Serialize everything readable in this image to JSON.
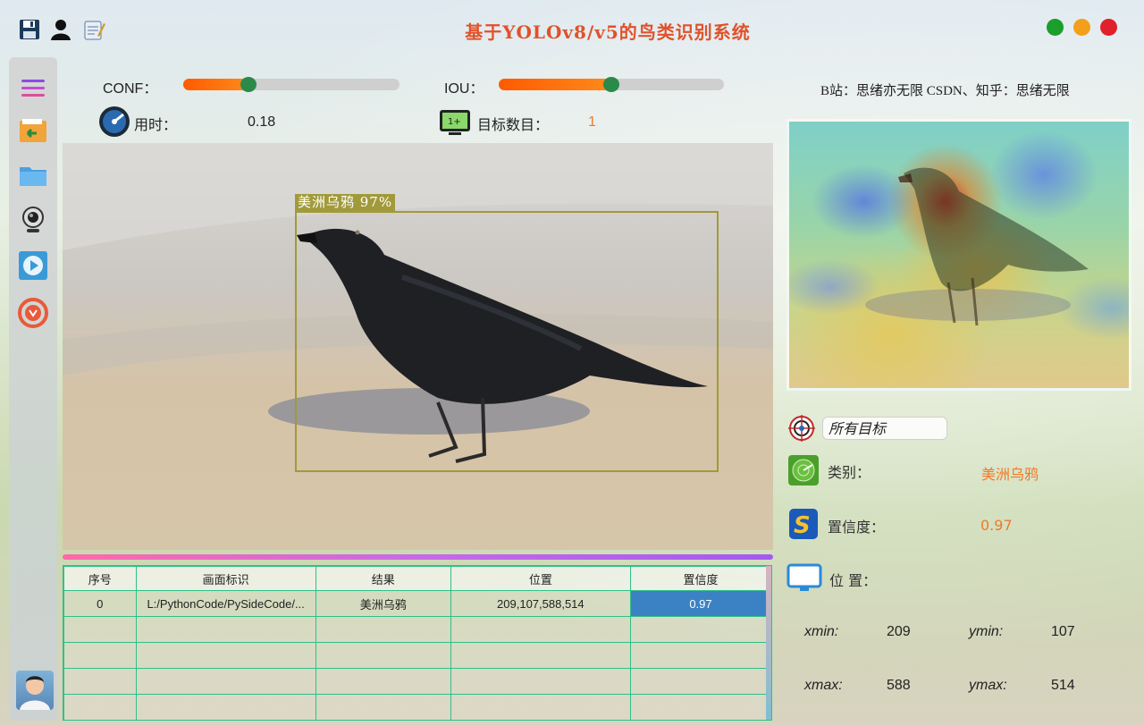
{
  "app": {
    "title": "基于YOLOv8/v5的鸟类识别系统",
    "toolbar_icons": [
      "save-icon",
      "user-icon",
      "notes-icon"
    ],
    "window_buttons": {
      "close_color": "#1a9e2c",
      "min_color": "#f2a01a",
      "max_color": "#e0202a"
    }
  },
  "params": {
    "conf_label": "CONF：",
    "conf_value": 0.3,
    "iou_label": "IOU：",
    "iou_value": 0.5,
    "time_label": "用时：",
    "time_value": "0.18",
    "count_label": "目标数目：",
    "count_value": "1"
  },
  "sidebar": {
    "items": [
      "menu-icon",
      "open-folder-icon",
      "folder-icon",
      "webcam-icon",
      "video-icon",
      "stop-icon"
    ]
  },
  "detection": {
    "label": "美洲乌鸦 97%",
    "box_color": "#a09a3a"
  },
  "table": {
    "headers": [
      "序号",
      "画面标识",
      "结果",
      "位置",
      "置信度"
    ],
    "rows": [
      [
        "0",
        "L:/PythonCode/PySideCode/...",
        "美洲乌鸦",
        "209,107,588,514",
        "0.97"
      ]
    ]
  },
  "right": {
    "credit": "B站：思绪亦无限  CSDN、知乎：思绪无限",
    "target_select": "所有目标",
    "class_label": "类别：",
    "class_value": "美洲乌鸦",
    "conf_label": "置信度：",
    "conf_value": "0.97",
    "pos_label": "位 置：",
    "xmin_label": "xmin:",
    "xmin_value": "209",
    "ymin_label": "ymin:",
    "ymin_value": "107",
    "xmax_label": "xmax:",
    "xmax_value": "588",
    "ymax_label": "ymax:",
    "ymax_value": "514"
  },
  "colors": {
    "accent_orange": "#f07a2a",
    "title_red": "#e0522a",
    "table_border": "#2fc08a",
    "selection_blue": "#3b82c4"
  }
}
